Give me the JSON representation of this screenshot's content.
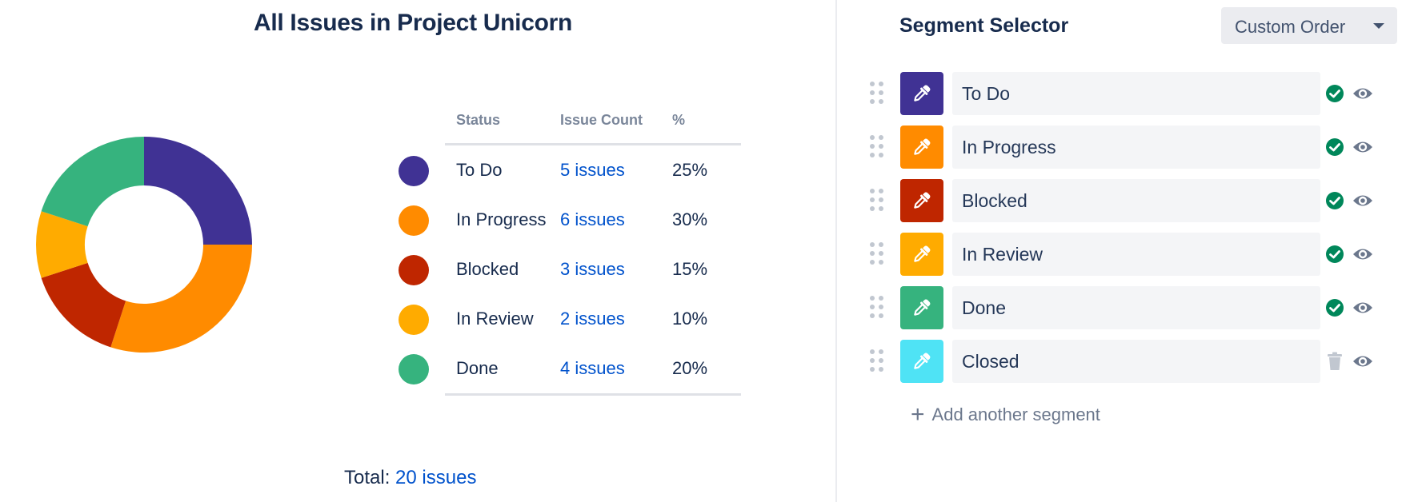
{
  "chart": {
    "title": "All Issues in Project Unicorn",
    "total_label": "Total:",
    "total_value": "20 issues"
  },
  "table": {
    "headers": {
      "status": "Status",
      "count": "Issue Count",
      "percent": "%"
    },
    "rows": [
      {
        "status": "To Do",
        "count": "5 issues",
        "percent": "25%",
        "color": "#403294"
      },
      {
        "status": "In Progress",
        "count": "6 issues",
        "percent": "30%",
        "color": "#ff8b00"
      },
      {
        "status": "Blocked",
        "count": "3 issues",
        "percent": "15%",
        "color": "#bf2600"
      },
      {
        "status": "In Review",
        "count": "2 issues",
        "percent": "10%",
        "color": "#ffab00"
      },
      {
        "status": "Done",
        "count": "4 issues",
        "percent": "20%",
        "color": "#36b37e"
      }
    ]
  },
  "chart_data": {
    "type": "pie",
    "categories": [
      "To Do",
      "In Progress",
      "Blocked",
      "In Review",
      "Done"
    ],
    "values": [
      5,
      6,
      3,
      2,
      4
    ],
    "colors": [
      "#403294",
      "#ff8b00",
      "#bf2600",
      "#ffab00",
      "#36b37e"
    ],
    "donut": true,
    "title": "All Issues in Project Unicorn"
  },
  "segments": {
    "title": "Segment Selector",
    "order_value": "Custom Order",
    "add_label": "Add another segment",
    "items": [
      {
        "label": "To Do",
        "color": "#403294",
        "state": "check-icon"
      },
      {
        "label": "In Progress",
        "color": "#ff8b00",
        "state": "check-icon"
      },
      {
        "label": "Blocked",
        "color": "#bf2600",
        "state": "check-icon"
      },
      {
        "label": "In Review",
        "color": "#ffab00",
        "state": "check-icon"
      },
      {
        "label": "Done",
        "color": "#36b37e",
        "state": "check-icon"
      },
      {
        "label": "Closed",
        "color": "#4fe3f5",
        "state": "trash-icon"
      }
    ]
  },
  "colors": {
    "link": "#0052cc",
    "success": "#00875a",
    "muted_icon": "#6b778c"
  }
}
